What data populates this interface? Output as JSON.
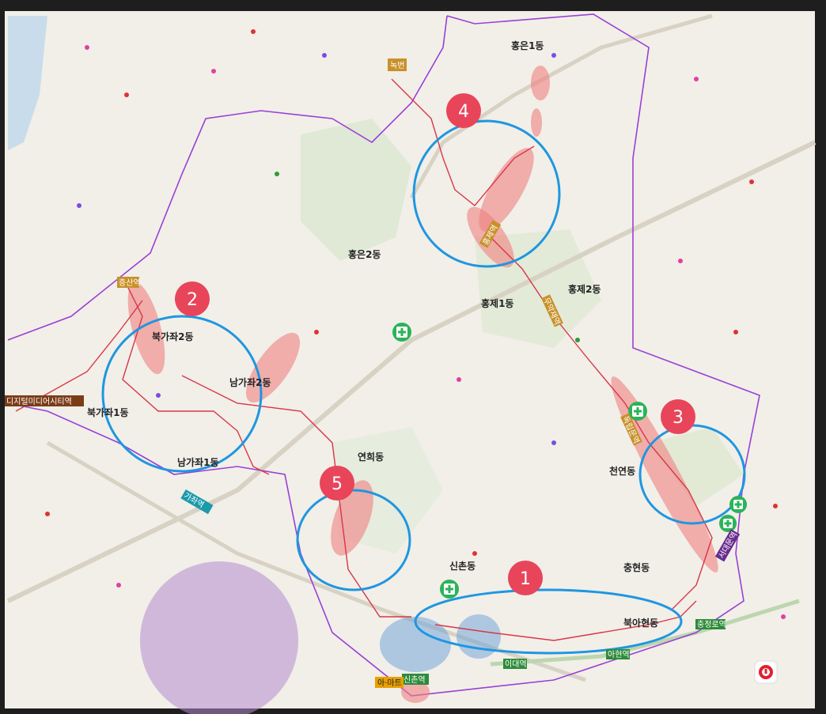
{
  "map": {
    "districts": [
      {
        "id": "d1",
        "name": "홍은1동"
      },
      {
        "id": "d2",
        "name": "홍은2동"
      },
      {
        "id": "d3",
        "name": "홍제2동"
      },
      {
        "id": "d4",
        "name": "홍제1동"
      },
      {
        "id": "d5",
        "name": "북가좌2동"
      },
      {
        "id": "d6",
        "name": "남가좌2동"
      },
      {
        "id": "d7",
        "name": "북가좌1동"
      },
      {
        "id": "d8",
        "name": "남가좌1동"
      },
      {
        "id": "d9",
        "name": "연희동"
      },
      {
        "id": "d10",
        "name": "천연동"
      },
      {
        "id": "d11",
        "name": "신촌동"
      },
      {
        "id": "d12",
        "name": "충현동"
      },
      {
        "id": "d13",
        "name": "북아현동"
      }
    ],
    "stations": [
      {
        "id": "s1",
        "name": "녹번",
        "color": "#c8912a"
      },
      {
        "id": "s2",
        "name": "디지털미디어시티역",
        "color": "#7a3d18"
      },
      {
        "id": "s3",
        "name": "증산역",
        "color": "#c8912a"
      },
      {
        "id": "s4",
        "name": "가좌역",
        "color": "#1b9aaa"
      },
      {
        "id": "s5",
        "name": "신촌역",
        "color": "#2e8b3a"
      },
      {
        "id": "s6",
        "name": "이대역",
        "color": "#2e8b3a"
      },
      {
        "id": "s7",
        "name": "아현역",
        "color": "#2e8b3a"
      },
      {
        "id": "s8",
        "name": "충정로역",
        "color": "#2e8b3a"
      },
      {
        "id": "s9",
        "name": "서대문역",
        "color": "#6a2c8e"
      },
      {
        "id": "s10",
        "name": "홍제역",
        "color": "#c8912a"
      },
      {
        "id": "s11",
        "name": "무악재역",
        "color": "#c8912a"
      },
      {
        "id": "s12",
        "name": "독립문역",
        "color": "#c8912a"
      },
      {
        "id": "s13",
        "name": "아·마트",
        "color": "#e8a000"
      }
    ],
    "zones": [
      {
        "id": "z1",
        "number": "1"
      },
      {
        "id": "z2",
        "number": "2"
      },
      {
        "id": "z3",
        "number": "3"
      },
      {
        "id": "z4",
        "number": "4"
      },
      {
        "id": "z5",
        "number": "5"
      }
    ],
    "hospital_icon": "plus-icon",
    "compass_icon": "location-pin-icon",
    "colors": {
      "zone_ring": "#1f96e0",
      "zone_badge": "#e8455a",
      "route": "#d9364a",
      "boundary": "#9b3fd6",
      "hotspot": "#f08080",
      "hospital": "#2bb35a",
      "purple_area": "#b48ad0"
    }
  }
}
